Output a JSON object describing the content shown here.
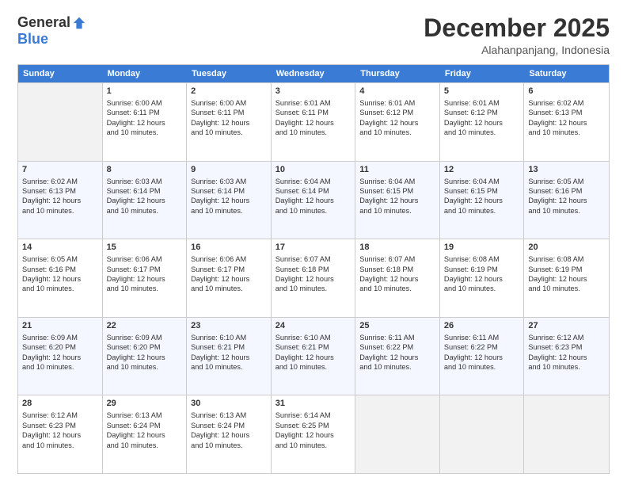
{
  "logo": {
    "general": "General",
    "blue": "Blue"
  },
  "title": "December 2025",
  "location": "Alahanpanjang, Indonesia",
  "days_header": [
    "Sunday",
    "Monday",
    "Tuesday",
    "Wednesday",
    "Thursday",
    "Friday",
    "Saturday"
  ],
  "weeks": [
    [
      {
        "empty": true
      },
      {
        "num": "1",
        "sunrise": "6:00 AM",
        "sunset": "6:11 PM",
        "daylight": "12 hours and 10 minutes."
      },
      {
        "num": "2",
        "sunrise": "6:00 AM",
        "sunset": "6:11 PM",
        "daylight": "12 hours and 10 minutes."
      },
      {
        "num": "3",
        "sunrise": "6:01 AM",
        "sunset": "6:11 PM",
        "daylight": "12 hours and 10 minutes."
      },
      {
        "num": "4",
        "sunrise": "6:01 AM",
        "sunset": "6:12 PM",
        "daylight": "12 hours and 10 minutes."
      },
      {
        "num": "5",
        "sunrise": "6:01 AM",
        "sunset": "6:12 PM",
        "daylight": "12 hours and 10 minutes."
      },
      {
        "num": "6",
        "sunrise": "6:02 AM",
        "sunset": "6:13 PM",
        "daylight": "12 hours and 10 minutes."
      }
    ],
    [
      {
        "num": "7",
        "sunrise": "6:02 AM",
        "sunset": "6:13 PM",
        "daylight": "12 hours and 10 minutes."
      },
      {
        "num": "8",
        "sunrise": "6:03 AM",
        "sunset": "6:14 PM",
        "daylight": "12 hours and 10 minutes."
      },
      {
        "num": "9",
        "sunrise": "6:03 AM",
        "sunset": "6:14 PM",
        "daylight": "12 hours and 10 minutes."
      },
      {
        "num": "10",
        "sunrise": "6:04 AM",
        "sunset": "6:14 PM",
        "daylight": "12 hours and 10 minutes."
      },
      {
        "num": "11",
        "sunrise": "6:04 AM",
        "sunset": "6:15 PM",
        "daylight": "12 hours and 10 minutes."
      },
      {
        "num": "12",
        "sunrise": "6:04 AM",
        "sunset": "6:15 PM",
        "daylight": "12 hours and 10 minutes."
      },
      {
        "num": "13",
        "sunrise": "6:05 AM",
        "sunset": "6:16 PM",
        "daylight": "12 hours and 10 minutes."
      }
    ],
    [
      {
        "num": "14",
        "sunrise": "6:05 AM",
        "sunset": "6:16 PM",
        "daylight": "12 hours and 10 minutes."
      },
      {
        "num": "15",
        "sunrise": "6:06 AM",
        "sunset": "6:17 PM",
        "daylight": "12 hours and 10 minutes."
      },
      {
        "num": "16",
        "sunrise": "6:06 AM",
        "sunset": "6:17 PM",
        "daylight": "12 hours and 10 minutes."
      },
      {
        "num": "17",
        "sunrise": "6:07 AM",
        "sunset": "6:18 PM",
        "daylight": "12 hours and 10 minutes."
      },
      {
        "num": "18",
        "sunrise": "6:07 AM",
        "sunset": "6:18 PM",
        "daylight": "12 hours and 10 minutes."
      },
      {
        "num": "19",
        "sunrise": "6:08 AM",
        "sunset": "6:19 PM",
        "daylight": "12 hours and 10 minutes."
      },
      {
        "num": "20",
        "sunrise": "6:08 AM",
        "sunset": "6:19 PM",
        "daylight": "12 hours and 10 minutes."
      }
    ],
    [
      {
        "num": "21",
        "sunrise": "6:09 AM",
        "sunset": "6:20 PM",
        "daylight": "12 hours and 10 minutes."
      },
      {
        "num": "22",
        "sunrise": "6:09 AM",
        "sunset": "6:20 PM",
        "daylight": "12 hours and 10 minutes."
      },
      {
        "num": "23",
        "sunrise": "6:10 AM",
        "sunset": "6:21 PM",
        "daylight": "12 hours and 10 minutes."
      },
      {
        "num": "24",
        "sunrise": "6:10 AM",
        "sunset": "6:21 PM",
        "daylight": "12 hours and 10 minutes."
      },
      {
        "num": "25",
        "sunrise": "6:11 AM",
        "sunset": "6:22 PM",
        "daylight": "12 hours and 10 minutes."
      },
      {
        "num": "26",
        "sunrise": "6:11 AM",
        "sunset": "6:22 PM",
        "daylight": "12 hours and 10 minutes."
      },
      {
        "num": "27",
        "sunrise": "6:12 AM",
        "sunset": "6:23 PM",
        "daylight": "12 hours and 10 minutes."
      }
    ],
    [
      {
        "num": "28",
        "sunrise": "6:12 AM",
        "sunset": "6:23 PM",
        "daylight": "12 hours and 10 minutes."
      },
      {
        "num": "29",
        "sunrise": "6:13 AM",
        "sunset": "6:24 PM",
        "daylight": "12 hours and 10 minutes."
      },
      {
        "num": "30",
        "sunrise": "6:13 AM",
        "sunset": "6:24 PM",
        "daylight": "12 hours and 10 minutes."
      },
      {
        "num": "31",
        "sunrise": "6:14 AM",
        "sunset": "6:25 PM",
        "daylight": "12 hours and 10 minutes."
      },
      {
        "empty": true
      },
      {
        "empty": true
      },
      {
        "empty": true
      }
    ]
  ]
}
